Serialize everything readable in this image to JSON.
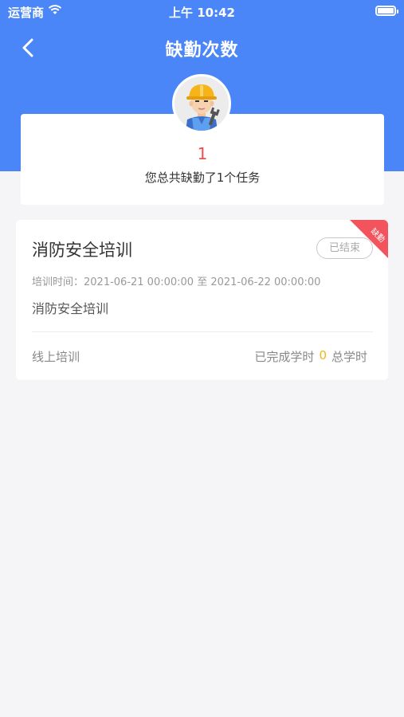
{
  "status_bar": {
    "carrier": "运营商",
    "time": "上午 10:42"
  },
  "nav": {
    "title": "缺勤次数",
    "back_icon": "chevron-left-icon"
  },
  "summary": {
    "count": "1",
    "text": "您总共缺勤了1个任务",
    "avatar_icon": "worker-avatar-icon"
  },
  "tasks": [
    {
      "title": "消防安全培训",
      "status": "已结束",
      "ribbon": "缺勤",
      "time": "培训时间：2021-06-21 00:00:00 至 2021-06-22 00:00:00",
      "desc": "消防安全培训",
      "type": "线上培训",
      "done_label": "已完成学时",
      "done_value": "0",
      "total_label": "总学时"
    }
  ],
  "colors": {
    "header": "#4a86f7",
    "count": "#f24d4d",
    "ribbon": "#f2535d",
    "hours_value": "#f3b41b"
  }
}
